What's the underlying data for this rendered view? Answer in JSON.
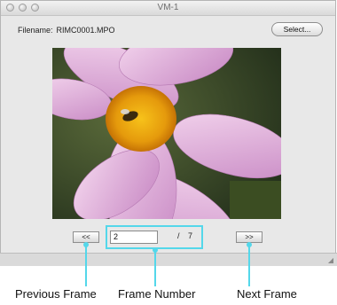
{
  "window": {
    "title": "VM-1"
  },
  "file": {
    "label": "Filename:",
    "value": "RIMC0001.MPO"
  },
  "toolbar": {
    "select_label": "Select..."
  },
  "navigation": {
    "prev_label": "<<",
    "next_label": ">>",
    "frame_value": "2",
    "frame_separator": "/",
    "frame_total": "7"
  },
  "image": {
    "description_icon": "photo-flower-icon"
  },
  "annotations": {
    "previous_frame": "Previous Frame",
    "frame_number": "Frame Number",
    "next_frame": "Next Frame"
  },
  "colors": {
    "callout": "#54d7ea",
    "window_bg": "#e8e8e8"
  }
}
